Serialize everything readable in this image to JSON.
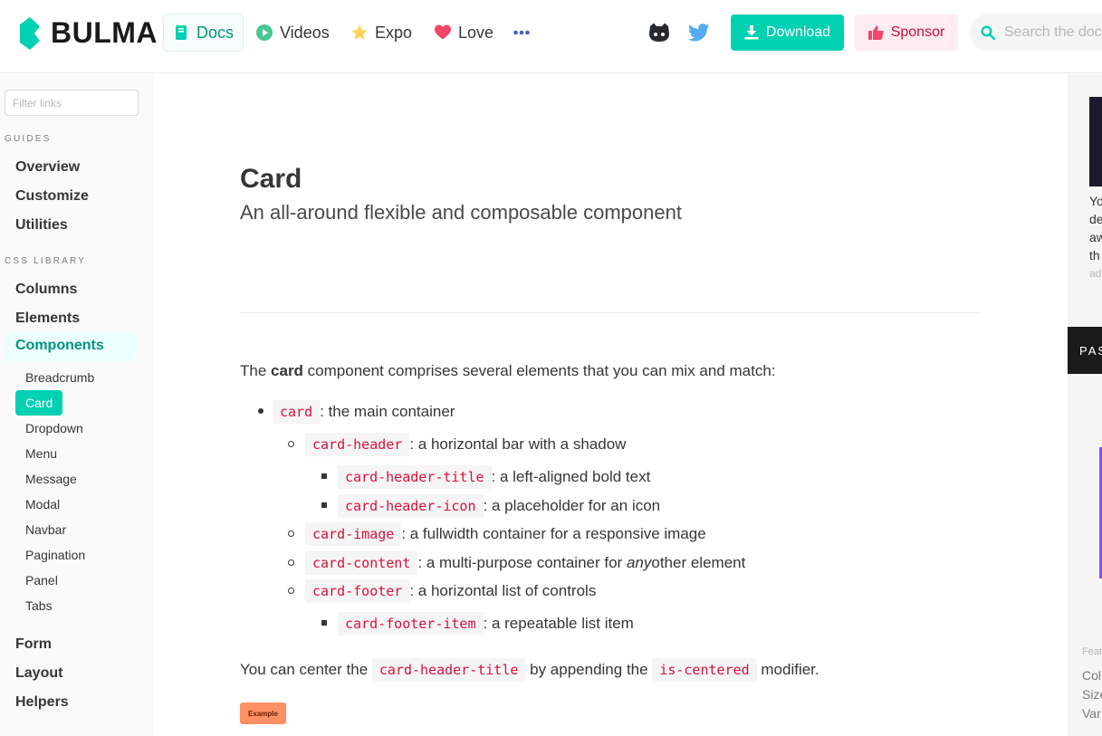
{
  "brand": {
    "name": "BULMA"
  },
  "nav": {
    "items": [
      {
        "label": "Docs",
        "icon": "book-icon"
      },
      {
        "label": "Videos",
        "icon": "play-icon"
      },
      {
        "label": "Expo",
        "icon": "star-icon"
      },
      {
        "label": "Love",
        "icon": "heart-icon"
      }
    ],
    "download_label": "Download",
    "sponsor_label": "Sponsor",
    "search_placeholder": "Search the docs"
  },
  "sidebar": {
    "filter_placeholder": "Filter links",
    "guides_label": "GUIDES",
    "guides": [
      "Overview",
      "Customize",
      "Utilities"
    ],
    "library_label": "CSS LIBRARY",
    "library": [
      "Columns",
      "Elements",
      "Components"
    ],
    "components": [
      "Breadcrumb",
      "Card",
      "Dropdown",
      "Menu",
      "Message",
      "Modal",
      "Navbar",
      "Pagination",
      "Panel",
      "Tabs"
    ],
    "more": [
      "Form",
      "Layout",
      "Helpers"
    ]
  },
  "main": {
    "title": "Card",
    "subtitle": "An all-around flexible and composable component",
    "intro_pre": "The ",
    "intro_bold": "card",
    "intro_post": " component comprises several elements that you can mix and match:",
    "items": [
      {
        "code": "card",
        "text": ": the main container"
      },
      {
        "code": "card-header",
        "text": ": a horizontal bar with a shadow"
      },
      {
        "code": "card-header-title",
        "text": ": a left-aligned bold text"
      },
      {
        "code": "card-header-icon",
        "text": ": a placeholder for an icon"
      },
      {
        "code": "card-image",
        "text": ": a fullwidth container for a responsive image"
      },
      {
        "code": "card-content",
        "text_pre": ": a multi-purpose container for ",
        "text_em": "any",
        "text_post": " other element"
      },
      {
        "code": "card-footer",
        "text": ": a horizontal list of controls"
      },
      {
        "code": "card-footer-item",
        "text": ": a repeatable list item"
      }
    ],
    "center_pre": "You can center the ",
    "center_code1": "card-header-title",
    "center_mid": " by appending the ",
    "center_code2": "is-centered",
    "center_post": " modifier.",
    "example_label": "Example"
  },
  "right": {
    "ad_lines": [
      "Yo",
      "de",
      "aw",
      "th"
    ],
    "ad_tag": "ad",
    "dark_label": "PAS",
    "feat_label": "Feat",
    "feat_items": [
      "Col",
      "Size",
      "Var"
    ]
  },
  "colors": {
    "primary": "#00d1b2",
    "primary_dark": "#00947e",
    "danger": "#cc0f35",
    "code": "#da1039"
  }
}
